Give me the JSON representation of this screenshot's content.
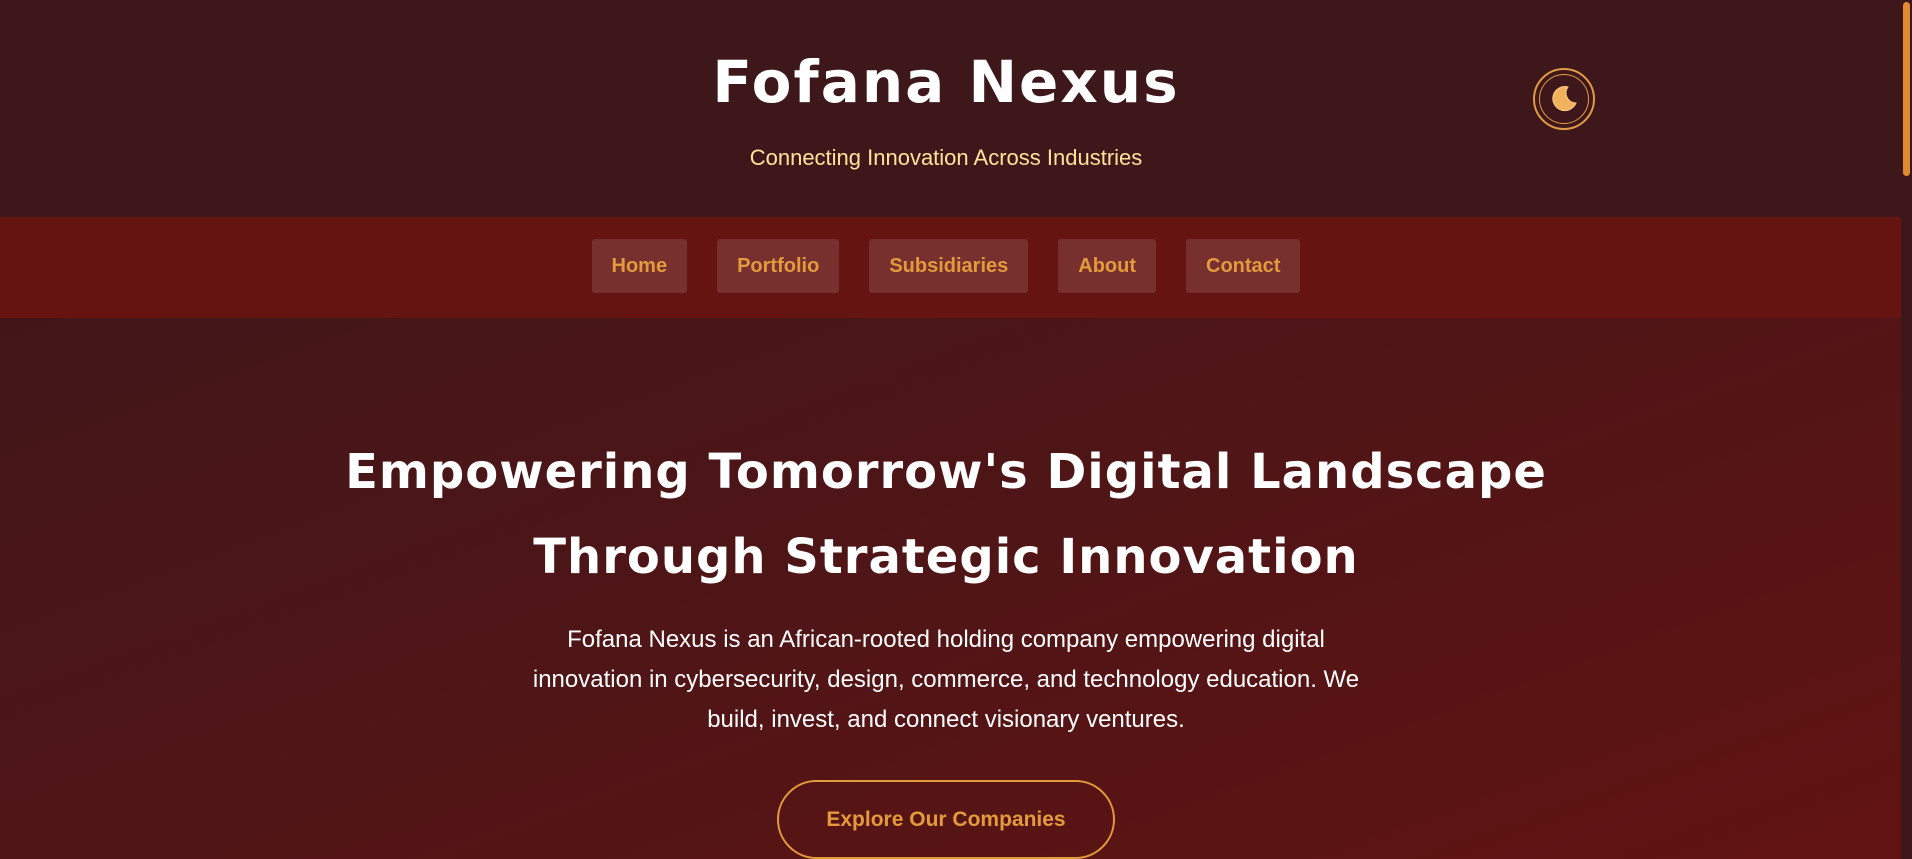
{
  "header": {
    "title": "Fofana Nexus",
    "tagline": "Connecting Innovation Across Industries",
    "theme_toggle_icon": "moon-icon"
  },
  "nav": {
    "items": [
      {
        "label": "Home"
      },
      {
        "label": "Portfolio"
      },
      {
        "label": "Subsidiaries"
      },
      {
        "label": "About"
      },
      {
        "label": "Contact"
      }
    ]
  },
  "hero": {
    "heading_line1": "Empowering Tomorrow's Digital Landscape",
    "heading_line2": "Through Strategic Innovation",
    "description": "Fofana Nexus is an African-rooted holding company empowering digital innovation in cybersecurity, design, commerce, and technology education. We build, invest, and connect visionary ventures.",
    "cta_label": "Explore Our Companies"
  },
  "colors": {
    "header_bg": "#3e171b",
    "nav_bg": "#661412",
    "accent": "#e39a3c",
    "tagline": "#ffe39a",
    "text": "#ffffff"
  }
}
